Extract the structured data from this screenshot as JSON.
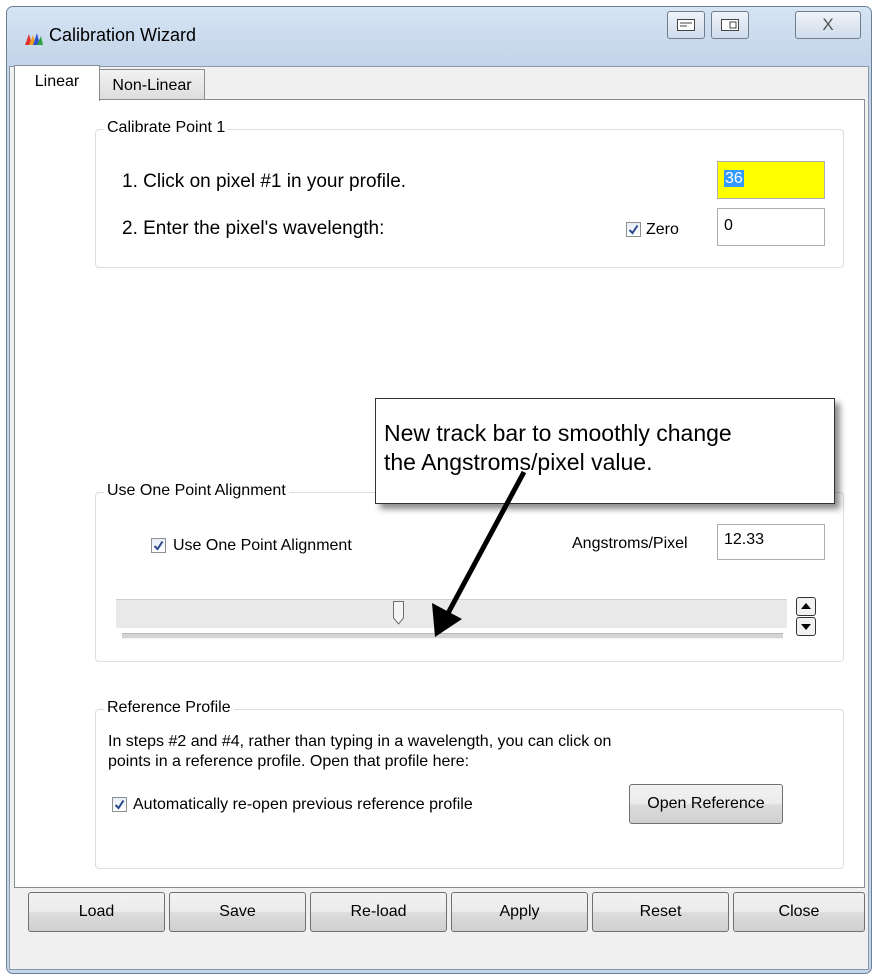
{
  "window": {
    "title": "Calibration Wizard",
    "close_glyph": "X"
  },
  "tabs": [
    {
      "label": "Linear",
      "active": true
    },
    {
      "label": "Non-Linear",
      "active": false
    }
  ],
  "calibrate_point": {
    "legend": "Calibrate Point 1",
    "step1": "1. Click on pixel #1 in your profile.",
    "step1_value": "36",
    "step1_highlight": "#ffff00",
    "step2": "2. Enter the pixel's wavelength:",
    "zero_label": "Zero",
    "zero_checked": true,
    "step2_value": "0"
  },
  "callout": {
    "line1": "New track bar to smoothly change",
    "line2": "the Angstroms/pixel value."
  },
  "one_point": {
    "legend": "Use One Point Alignment",
    "checkbox_label": "Use One Point Alignment",
    "checked": true,
    "angstroms_label": "Angstroms/Pixel",
    "angstroms_value": "12.33",
    "slider_position": 0.42
  },
  "reference": {
    "legend": "Reference Profile",
    "description_line1": "In steps #2 and #4, rather than typing in a wavelength, you can click on",
    "description_line2": "points in a reference profile. Open that profile here:",
    "checkbox_label": "Automatically re-open previous reference profile",
    "checked": true,
    "open_button": "Open Reference"
  },
  "footer_buttons": [
    "Load",
    "Save",
    "Re-load",
    "Apply",
    "Reset",
    "Close"
  ],
  "colors": {
    "title_bar": "#c3d5ea",
    "checkmark": "#2c4a8a",
    "highlight": "#ffff00",
    "selection": "#3399ff"
  },
  "icons": {
    "app": "spectrum-icon",
    "close": "close-icon",
    "checkbox": "checkmark-icon",
    "spin_up": "triangle-up-icon",
    "spin_down": "triangle-down-icon"
  }
}
